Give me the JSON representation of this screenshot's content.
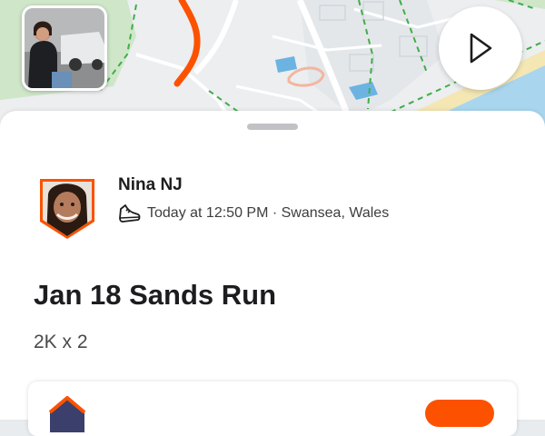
{
  "map": {
    "route_color": "#fc5200",
    "land_color": "#eef0f2",
    "park_color": "#cfe6c9",
    "water_color": "#a9d6ee"
  },
  "photo": {
    "icon": "photo-thumbnail"
  },
  "play": {
    "icon": "play-icon"
  },
  "athlete": {
    "name": "Nina NJ",
    "meta": "Today at 12:50 PM · Swansea, Wales",
    "activity_icon": "running-shoe-icon"
  },
  "activity": {
    "title": "Jan 18 Sands Run",
    "description": "2K x 2"
  },
  "colors": {
    "accent": "#fc5200",
    "text": "#1d1d1f"
  }
}
